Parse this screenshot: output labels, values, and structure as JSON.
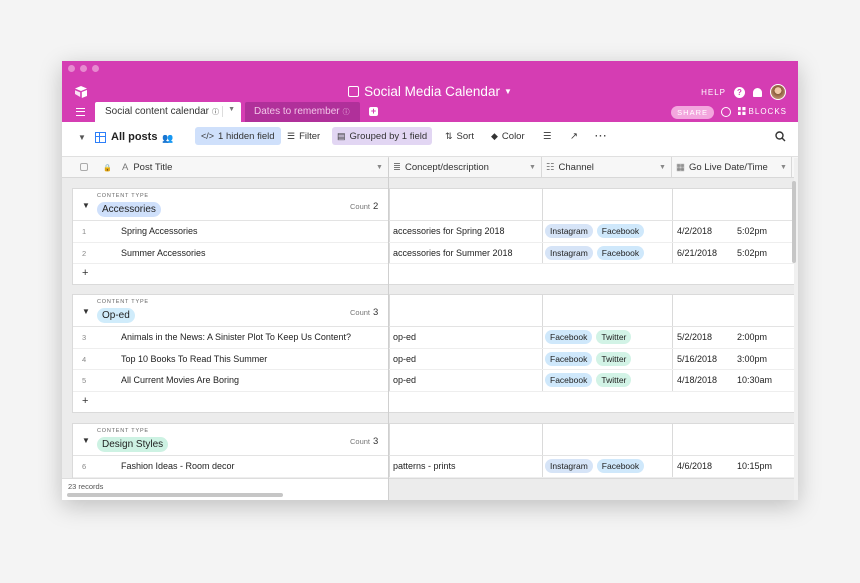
{
  "app": {
    "base_title": "Social Media Calendar",
    "help_label": "HELP",
    "share_label": "SHARE",
    "blocks_label": "BLOCKS"
  },
  "tabs": [
    {
      "label": "Social content calendar",
      "active": true
    },
    {
      "label": "Dates to remember",
      "active": false
    }
  ],
  "toolbar": {
    "view_name": "All posts",
    "hidden_fields": "1 hidden field",
    "filter": "Filter",
    "grouped": "Grouped by 1 field",
    "sort": "Sort",
    "color": "Color",
    "more": "···"
  },
  "columns": [
    {
      "label": "Post Title",
      "icon": "text-icon"
    },
    {
      "label": "Concept/description",
      "icon": "long-text-icon"
    },
    {
      "label": "Channel",
      "icon": "multi-select-icon"
    },
    {
      "label": "Go Live Date/Time",
      "icon": "date-icon"
    }
  ],
  "colors": {
    "brand": "#d53db3",
    "blue_pill": "#cfe0fb",
    "green_pill": "#cdf2e3",
    "pink_pill": "#f9d6ef"
  },
  "groups": [
    {
      "label": "CONTENT TYPE",
      "value": "Accessories",
      "pill_color": "#cfe0fb",
      "count_label": "Count",
      "count": "2",
      "rows": [
        {
          "num": "1",
          "title": "Spring Accessories",
          "concept": "accessories for Spring 2018",
          "channels": [
            "Instagram",
            "Facebook"
          ],
          "date": "4/2/2018",
          "time": "5:02pm"
        },
        {
          "num": "2",
          "title": "Summer Accessories",
          "concept": "accessories for Summer 2018",
          "channels": [
            "Instagram",
            "Facebook"
          ],
          "date": "6/21/2018",
          "time": "5:02pm"
        }
      ]
    },
    {
      "label": "CONTENT TYPE",
      "value": "Op-ed",
      "pill_color": "#d0ecfb",
      "count_label": "Count",
      "count": "3",
      "rows": [
        {
          "num": "3",
          "title": "Animals in the News: A Sinister Plot To Keep Us Content?",
          "concept": "op-ed",
          "channels": [
            "Facebook",
            "Twitter"
          ],
          "date": "5/2/2018",
          "time": "2:00pm"
        },
        {
          "num": "4",
          "title": "Top 10 Books To Read This Summer",
          "concept": "op-ed",
          "channels": [
            "Facebook",
            "Twitter"
          ],
          "date": "5/16/2018",
          "time": "3:00pm"
        },
        {
          "num": "5",
          "title": "All Current Movies Are Boring",
          "concept": "op-ed",
          "channels": [
            "Facebook",
            "Twitter"
          ],
          "date": "4/18/2018",
          "time": "10:30am"
        }
      ]
    },
    {
      "label": "CONTENT TYPE",
      "value": "Design Styles",
      "pill_color": "#cdf2e3",
      "count_label": "Count",
      "count": "3",
      "rows": [
        {
          "num": "6",
          "title": "Fashion Ideas - Room decor",
          "concept": "patterns - prints",
          "channels": [
            "Instagram",
            "Facebook"
          ],
          "date": "4/6/2018",
          "time": "10:15pm"
        }
      ]
    }
  ],
  "channel_colors": {
    "Instagram": "#d6e4f7",
    "Facebook": "#cfe8fb",
    "Twitter": "#d2f3e6"
  },
  "add_row_label": "+",
  "footer": {
    "records": "23 records"
  }
}
